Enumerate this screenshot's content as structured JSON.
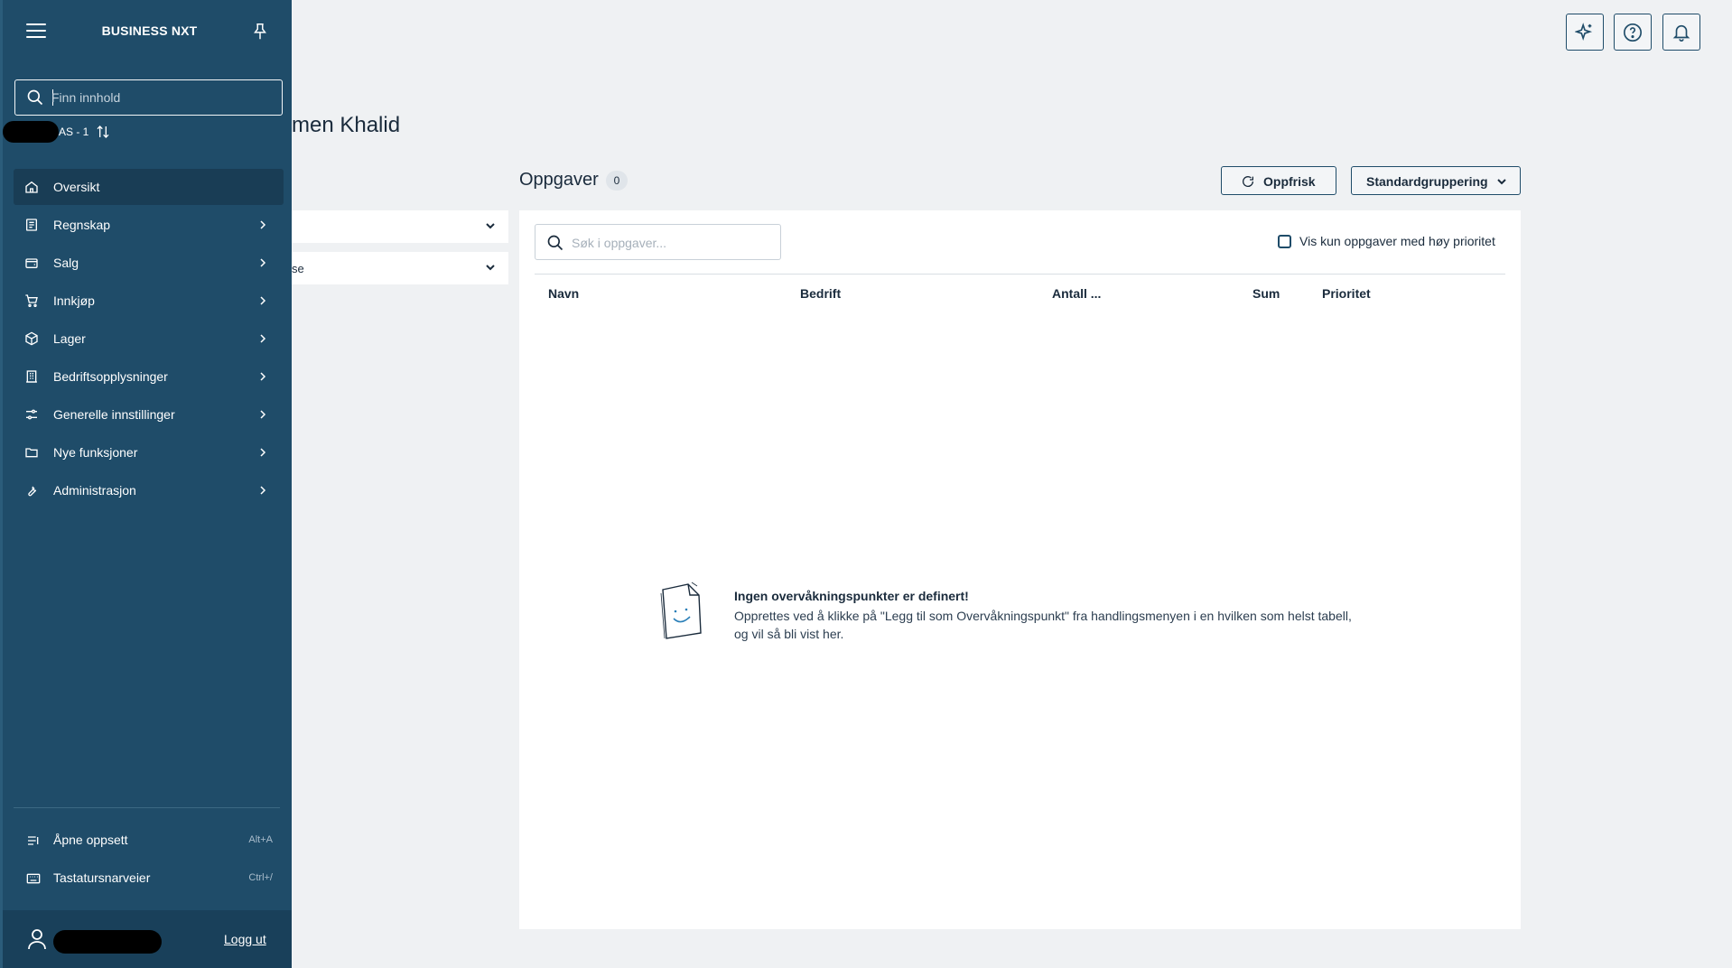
{
  "sidebar": {
    "title": "BUSINESS NXT",
    "search_placeholder": "Finn innhold",
    "company_label": "AS - 1",
    "nav_items": [
      {
        "label": "Oversikt",
        "icon": "home-icon",
        "active": true,
        "has_children": false
      },
      {
        "label": "Regnskap",
        "icon": "ledger-icon",
        "active": false,
        "has_children": true
      },
      {
        "label": "Salg",
        "icon": "wallet-icon",
        "active": false,
        "has_children": true
      },
      {
        "label": "Innkjøp",
        "icon": "cart-icon",
        "active": false,
        "has_children": true
      },
      {
        "label": "Lager",
        "icon": "box-icon",
        "active": false,
        "has_children": true
      },
      {
        "label": "Bedriftsopplysninger",
        "icon": "building-icon",
        "active": false,
        "has_children": true
      },
      {
        "label": "Generelle innstillinger",
        "icon": "sliders-icon",
        "active": false,
        "has_children": true
      },
      {
        "label": "Nye funksjoner",
        "icon": "folder-icon",
        "active": false,
        "has_children": true
      },
      {
        "label": "Administrasjon",
        "icon": "wrench-icon",
        "active": false,
        "has_children": true
      }
    ],
    "bottom_items": [
      {
        "label": "Åpne oppsett",
        "shortcut": "Alt+A",
        "icon": "layout-icon"
      },
      {
        "label": "Tastatursnarveier",
        "shortcut": "Ctrl+/",
        "icon": "keyboard-icon"
      }
    ],
    "logout_label": "Logg ut"
  },
  "main": {
    "page_title": "men Khalid",
    "left_panel_2_label": "se",
    "tasks": {
      "title": "Oppgaver",
      "count": "0",
      "refresh_label": "Oppfrisk",
      "grouping_label": "Standardgruppering",
      "search_placeholder": "Søk i oppgaver...",
      "priority_checkbox_label": "Vis kun oppgaver med høy prioritet",
      "priority_checked": false,
      "columns": [
        "Navn",
        "Bedrift",
        "Antall ...",
        "Sum",
        "Prioritet"
      ],
      "empty_title": "Ingen overvåkningspunkter er definert!",
      "empty_line_1": "Opprettes ved å klikke på \"Legg til som Overvåkningspunkt\" fra handlingsmenyen i en hvilken som helst tabell,",
      "empty_line_2": "og vil så bli vist her."
    }
  },
  "header_icons": [
    "sparkle-icon",
    "help-icon",
    "bell-icon"
  ],
  "colors": {
    "sidebar": "#1f4c69",
    "sidebar_active": "#193d55",
    "background": "#eff1f3",
    "accent": "#1f4c69"
  }
}
